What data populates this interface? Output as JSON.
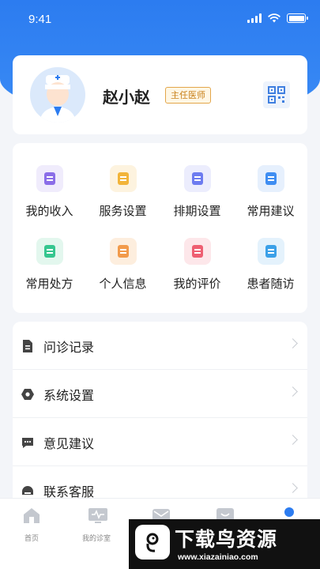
{
  "status_bar": {
    "time": "9:41"
  },
  "profile": {
    "name": "赵小赵",
    "title_badge": "主任医师"
  },
  "grid": {
    "items": [
      {
        "label": "我的收入",
        "icon": "clipboard-icon",
        "color": "#8b6ee8",
        "bg": "#f0ecfc"
      },
      {
        "label": "服务设置",
        "icon": "document-icon",
        "color": "#f2b43a",
        "bg": "#fdf3df"
      },
      {
        "label": "排期设置",
        "icon": "calendar-icon",
        "color": "#6d7cf0",
        "bg": "#ecedfd"
      },
      {
        "label": "常用建议",
        "icon": "chat-bubble-icon",
        "color": "#3f8ef2",
        "bg": "#e6f0fd"
      },
      {
        "label": "常用处方",
        "icon": "prescription-icon",
        "color": "#35c68f",
        "bg": "#e3f7ee"
      },
      {
        "label": "个人信息",
        "icon": "id-card-icon",
        "color": "#f29a4a",
        "bg": "#fdeede"
      },
      {
        "label": "我的评价",
        "icon": "review-icon",
        "color": "#ee5f72",
        "bg": "#fde7ea"
      },
      {
        "label": "患者随访",
        "icon": "followup-icon",
        "color": "#3ba0e8",
        "bg": "#e4f2fc"
      }
    ]
  },
  "menu": {
    "items": [
      {
        "label": "问诊记录",
        "icon": "record-icon"
      },
      {
        "label": "系统设置",
        "icon": "settings-icon"
      },
      {
        "label": "意见建议",
        "icon": "feedback-icon"
      },
      {
        "label": "联系客服",
        "icon": "customer-service-icon"
      }
    ]
  },
  "tabbar": {
    "items": [
      {
        "label": "首页",
        "icon": "home-icon"
      },
      {
        "label": "我的诊室",
        "icon": "clinic-icon"
      },
      {
        "label": "",
        "icon": "message-icon"
      },
      {
        "label": "",
        "icon": "patient-icon"
      },
      {
        "label": "",
        "icon": "profile-icon"
      }
    ],
    "active_color": "#2c7cf0",
    "inactive_color": "#c4c8cf"
  },
  "watermark": {
    "text": "下载鸟资源",
    "url": "www.xiazainiao.com"
  }
}
